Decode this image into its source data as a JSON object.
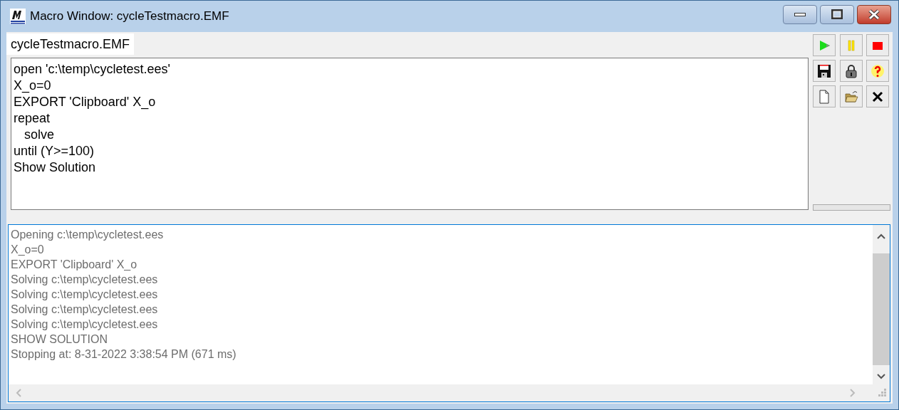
{
  "window": {
    "title": "Macro Window: cycleTestmacro.EMF"
  },
  "tabs": [
    {
      "label": "cycleTestmacro.EMF",
      "selected": true
    }
  ],
  "editor": {
    "lines": [
      "open 'c:\\temp\\cycletest.ees'",
      "X_o=0",
      "EXPORT 'Clipboard' X_o",
      "repeat",
      "   solve",
      "until (Y>=100)",
      "Show Solution"
    ]
  },
  "toolbar": [
    {
      "kind": "run"
    },
    {
      "kind": "pause"
    },
    {
      "kind": "stop"
    },
    {
      "kind": "save"
    },
    {
      "kind": "lock"
    },
    {
      "kind": "help"
    },
    {
      "kind": "new"
    },
    {
      "kind": "open"
    },
    {
      "kind": "close"
    }
  ],
  "output": {
    "lines": [
      "Opening c:\\temp\\cycletest.ees",
      "X_o=0",
      "EXPORT 'Clipboard' X_o",
      "Solving c:\\temp\\cycletest.ees",
      "Solving c:\\temp\\cycletest.ees",
      "Solving c:\\temp\\cycletest.ees",
      "Solving c:\\temp\\cycletest.ees",
      "SHOW SOLUTION",
      "Stopping at: 8-31-2022 3:38:54 PM (671 ms)"
    ]
  }
}
